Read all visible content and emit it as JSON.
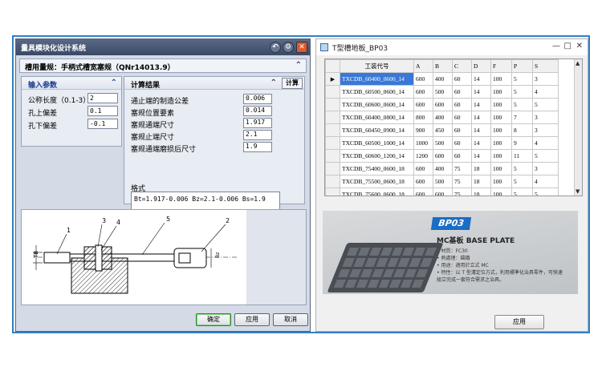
{
  "left_window": {
    "title": "量具模块化设计系统",
    "spec_title": "槽用量规：手柄式槽宽塞规（QNr14013.9）",
    "input_panel": {
      "title": "输入参数",
      "fields": [
        {
          "label": "公称长度（0.1-3）",
          "value": "2"
        },
        {
          "label": "孔上偏差",
          "value": "0.1"
        },
        {
          "label": "孔下偏差",
          "value": "-0.1"
        }
      ]
    },
    "result_panel": {
      "title": "计算结果",
      "calc_button": "计算",
      "rows": [
        {
          "label": "通止端的制造公差",
          "value": "0.006"
        },
        {
          "label": "塞规位置要素",
          "value": "0.014"
        },
        {
          "label": "塞规通端尺寸",
          "value": "1.917"
        },
        {
          "label": "塞规止端尺寸",
          "value": "2.1"
        },
        {
          "label": "塞规通端磨损后尺寸",
          "value": "1.9"
        }
      ],
      "format_label": "格式",
      "format_text": "Bt=1.917-0.006  Bz=2.1-0.006  Bs=1.9"
    },
    "drawing": {
      "labels": [
        "1",
        "3",
        "4",
        "5",
        "2"
      ],
      "dim_left": "TB",
      "dim_right": "Bz"
    },
    "buttons": {
      "ok": "确定",
      "apply": "应用",
      "cancel": "取消"
    }
  },
  "right_window": {
    "title": "T型槽地板_BP03",
    "table": {
      "headers": [
        "工装代号",
        "A",
        "B",
        "C",
        "D",
        "F",
        "P",
        "S"
      ],
      "rows": [
        [
          "TXCDB_60400_0600_14",
          "600",
          "400",
          "60",
          "14",
          "100",
          "5",
          "3"
        ],
        [
          "TXCDB_60500_0600_14",
          "600",
          "500",
          "60",
          "14",
          "100",
          "5",
          "4"
        ],
        [
          "TXCDB_60600_0600_14",
          "600",
          "600",
          "60",
          "14",
          "100",
          "5",
          "5"
        ],
        [
          "TXCDB_60400_0800_14",
          "800",
          "400",
          "60",
          "14",
          "100",
          "7",
          "3"
        ],
        [
          "TXCDB_60450_0900_14",
          "900",
          "450",
          "60",
          "14",
          "100",
          "8",
          "3"
        ],
        [
          "TXCDB_60500_1000_14",
          "1000",
          "500",
          "60",
          "14",
          "100",
          "9",
          "4"
        ],
        [
          "TXCDB_60600_1200_14",
          "1200",
          "600",
          "60",
          "14",
          "100",
          "11",
          "5"
        ],
        [
          "TXCDB_75400_0600_18",
          "600",
          "400",
          "75",
          "18",
          "100",
          "5",
          "3"
        ],
        [
          "TXCDB_75500_0600_18",
          "600",
          "500",
          "75",
          "18",
          "100",
          "5",
          "4"
        ],
        [
          "TXCDB_75600_0600_18",
          "600",
          "600",
          "75",
          "18",
          "100",
          "5",
          "5"
        ]
      ],
      "selected_row": 0
    },
    "photo": {
      "badge": "BP03",
      "title": "MC基板  BASE PLATE",
      "notes": [
        "• 材質：FC30",
        "• 熱處理：鑄鐵",
        "• 用途：適用於立式 MC",
        "• 特性：以 T 型溝定位方式，利用標準化治具零件，可快速組立完成一套符合需求之治具。"
      ]
    },
    "apply_button": "应用"
  }
}
